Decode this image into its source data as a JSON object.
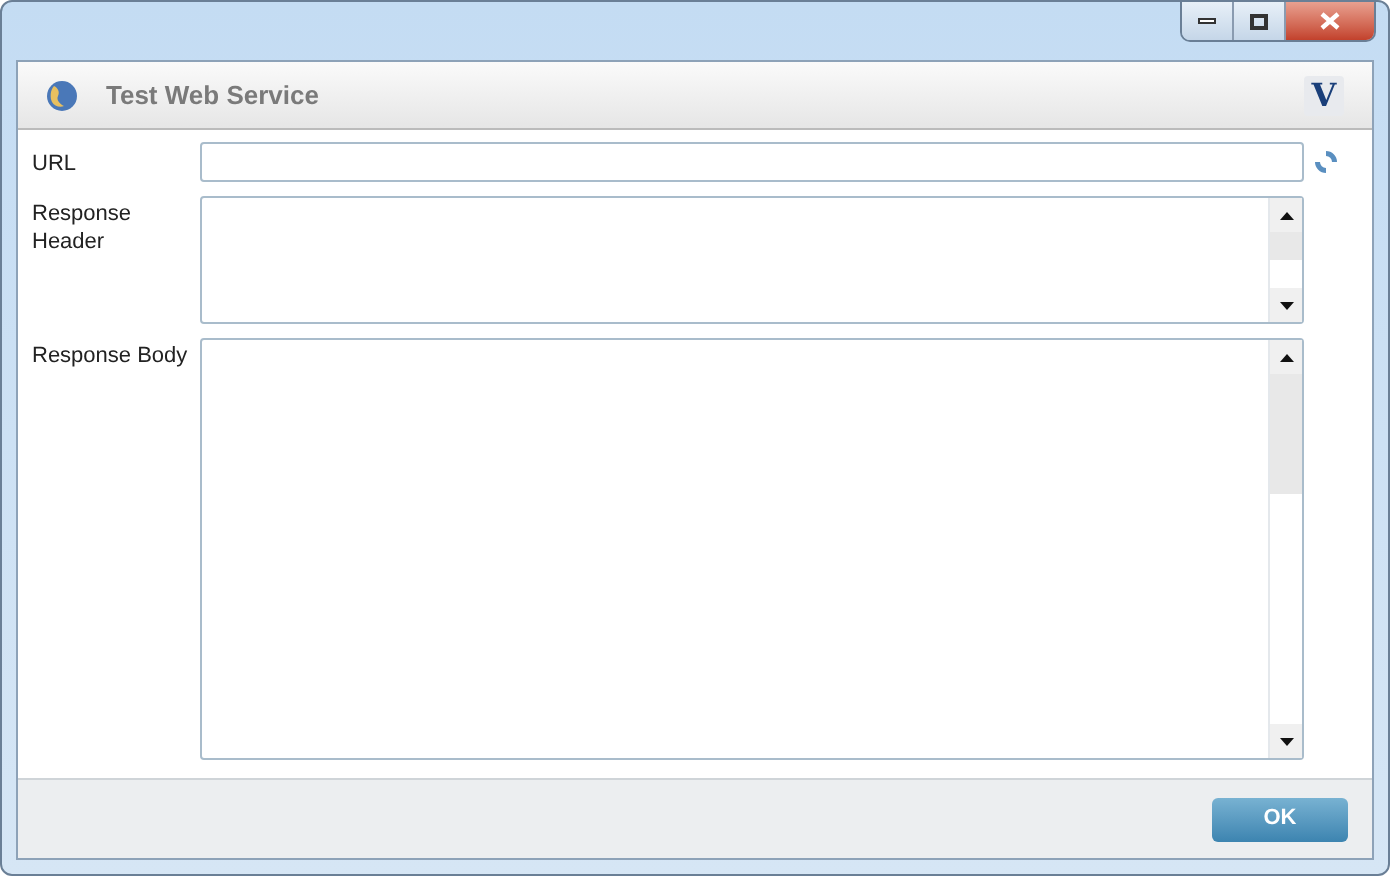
{
  "window": {
    "title": "Test Web Service",
    "logo": "V"
  },
  "fields": [
    {
      "kind": "input",
      "label": "URL"
    },
    {
      "kind": "textarea",
      "label": "Response Header"
    },
    {
      "kind": "textarea",
      "label": "Response Body"
    }
  ],
  "buttons": [
    "OK"
  ]
}
